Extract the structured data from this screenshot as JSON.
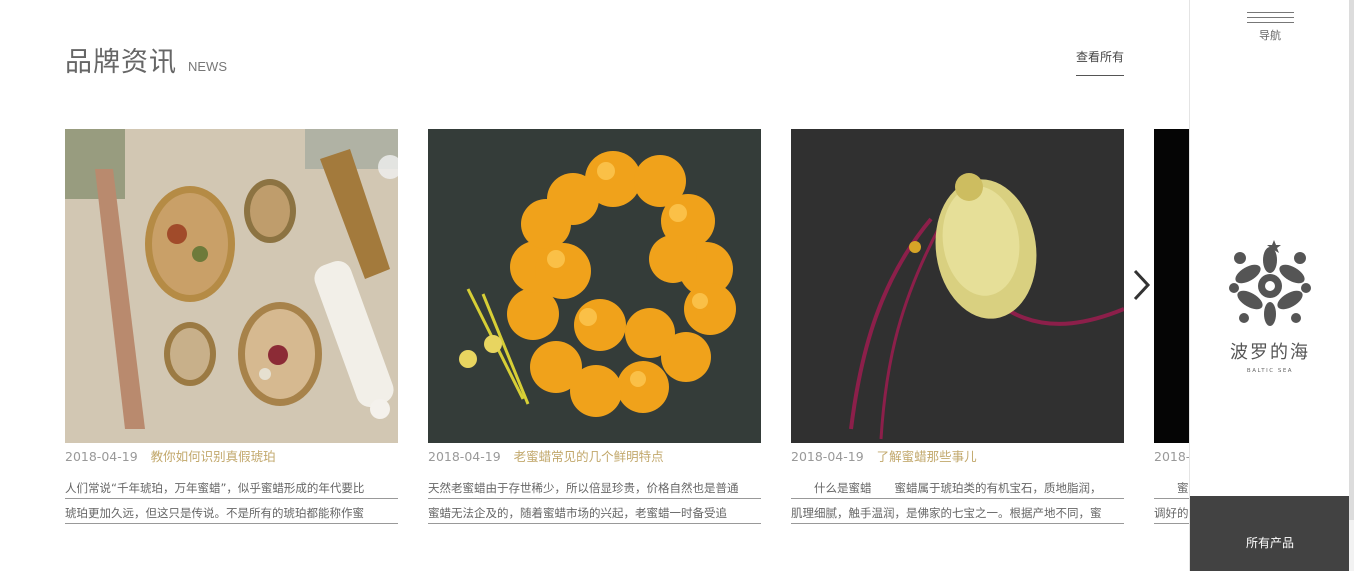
{
  "header": {
    "title": "品牌资讯",
    "subtitle": "NEWS",
    "view_all": "查看所有"
  },
  "articles": [
    {
      "date": "2018-04-19",
      "title": "教你如何识别真假琥珀",
      "excerpt_lines": [
        "人们常说“千年琥珀，万年蜜蜡”，似乎蜜蜡形成的年代要比",
        "琥珀更加久远，但这只是传说。不是所有的琥珀都能称作蜜"
      ],
      "image": "amber-jewelry-photo"
    },
    {
      "date": "2018-04-19",
      "title": "老蜜蜡常见的几个鲜明特点",
      "excerpt_lines": [
        "天然老蜜蜡由于存世稀少，所以倍显珍贵，价格自然也是普通",
        "蜜蜡无法企及的，随着蜜蜡市场的兴起，老蜜蜡一时备受追"
      ],
      "image": "amber-bead-bracelet-photo"
    },
    {
      "date": "2018-04-19",
      "title": "了解蜜蜡那些事儿",
      "excerpt_lines": [
        "　　什么是蜜蜡　　蜜蜡属于琥珀类的有机宝石，质地脂润，",
        "肌理细腻，触手温润，是佛家的七宝之一。根据产地不同，蜜"
      ],
      "image": "amber-pendant-photo"
    },
    {
      "date": "2018-0",
      "title": "",
      "excerpt_lines": [
        "　　蜜",
        "调好的"
      ],
      "image": "dark-photo"
    }
  ],
  "sidebar": {
    "menu_label": "导航",
    "logo_cn": "波罗的海",
    "logo_en": "BALTIC SEA",
    "all_products": "所有产品"
  },
  "colors": {
    "accent_title": "#c2a86c",
    "date": "#999999",
    "sidebar_button": "#424242"
  },
  "icons": [
    "hamburger-menu-icon",
    "chevron-right-icon",
    "baltic-sea-floral-logo"
  ]
}
